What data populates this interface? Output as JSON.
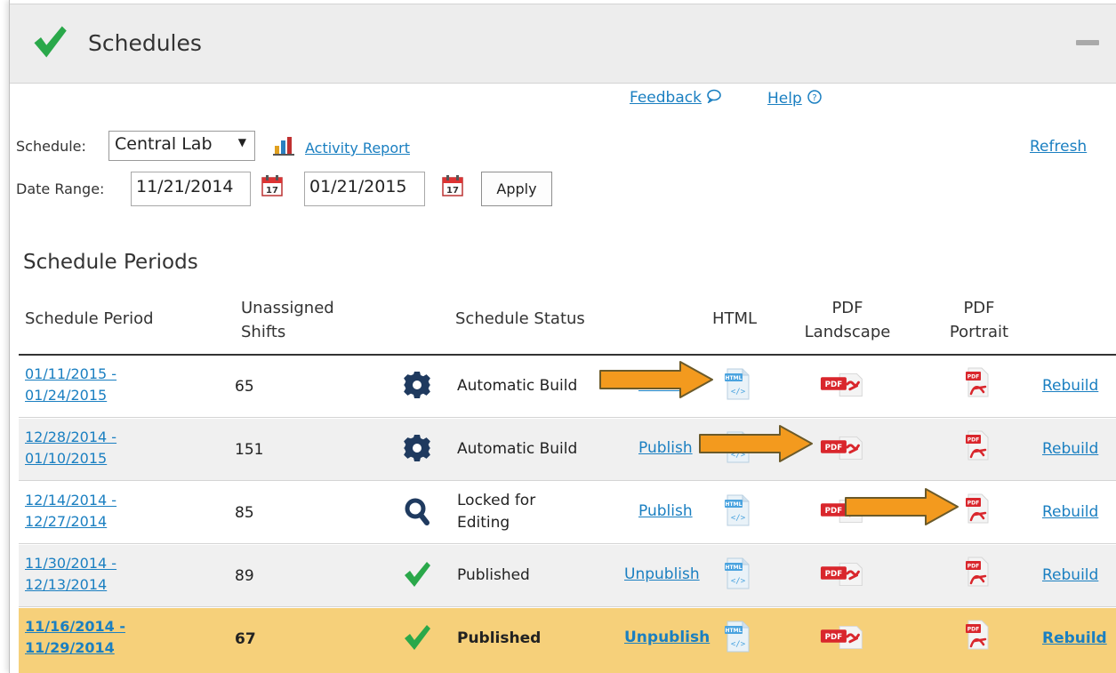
{
  "header": {
    "title": "Schedules"
  },
  "top_links": {
    "feedback": "Feedback",
    "help": "Help"
  },
  "controls": {
    "schedule_label": "Schedule:",
    "schedule_value": "Central Lab",
    "activity_report": "Activity Report",
    "refresh": "Refresh",
    "date_range_label": "Date Range:",
    "start_date": "11/21/2014",
    "end_date": "01/21/2015",
    "apply": "Apply"
  },
  "section_title": "Schedule Periods",
  "columns": {
    "period": "Schedule Period",
    "unassigned_1": "Unassigned",
    "unassigned_2": "Shifts",
    "status": "Schedule Status",
    "html": "HTML",
    "pdf_landscape_1": "PDF",
    "pdf_landscape_2": "Landscape",
    "pdf_portrait_1": "PDF",
    "pdf_portrait_2": "Portrait"
  },
  "rows": [
    {
      "period_1": "01/11/2015 -",
      "period_2": "01/24/2015",
      "shifts": "65",
      "status_1": "Automatic Build",
      "status_2": "",
      "status_icon": "gear-icon",
      "publish_action": "Publish",
      "rebuild": "Rebuild"
    },
    {
      "period_1": "12/28/2014 -",
      "period_2": "01/10/2015",
      "shifts": "151",
      "status_1": "Automatic Build",
      "status_2": "",
      "status_icon": "gear-icon",
      "publish_action": "Publish",
      "rebuild": "Rebuild"
    },
    {
      "period_1": "12/14/2014 -",
      "period_2": "12/27/2014",
      "shifts": "85",
      "status_1": "Locked for",
      "status_2": "Editing",
      "status_icon": "magnifier-icon",
      "publish_action": "Publish",
      "rebuild": "Rebuild"
    },
    {
      "period_1": "11/30/2014 -",
      "period_2": "12/13/2014",
      "shifts": "89",
      "status_1": "Published",
      "status_2": "",
      "status_icon": "checkmark-icon",
      "publish_action": "Unpublish",
      "rebuild": "Rebuild"
    },
    {
      "period_1": "11/16/2014 -",
      "period_2": "11/29/2014",
      "shifts": "67",
      "status_1": "Published",
      "status_2": "",
      "status_icon": "checkmark-icon",
      "publish_action": "Unpublish",
      "rebuild": "Rebuild",
      "highlighted": true
    }
  ],
  "colors": {
    "link": "#1a7fc1",
    "highlight_row": "#f6d07a",
    "arrow": "#f39a1e",
    "check": "#2aa84a",
    "pdf_red": "#d9262c"
  }
}
